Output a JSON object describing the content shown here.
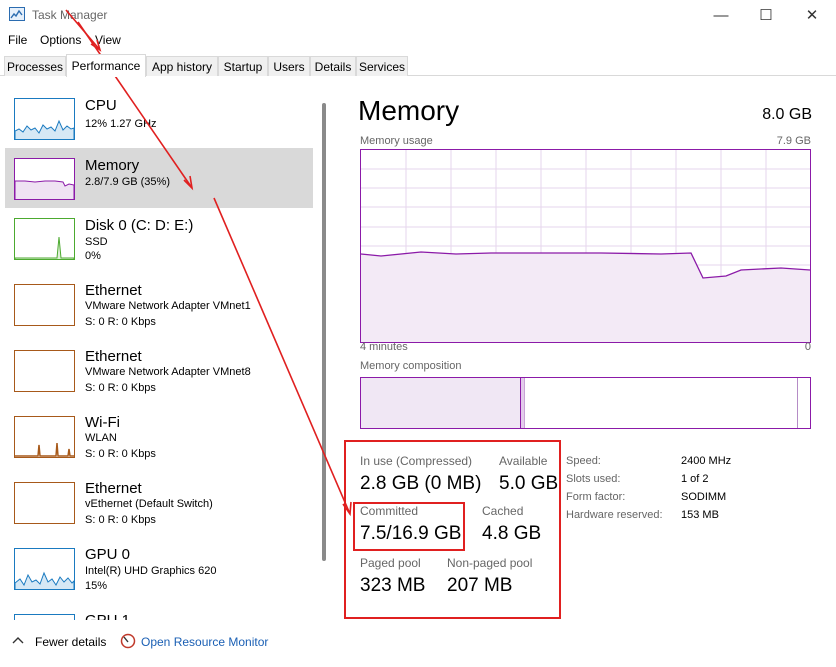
{
  "window": {
    "title": "Task Manager",
    "minimize": "—",
    "maximize": "☐",
    "close": "✕"
  },
  "menu": [
    "File",
    "Options",
    "View"
  ],
  "tabs": [
    "Processes",
    "Performance",
    "App history",
    "Startup",
    "Users",
    "Details",
    "Services"
  ],
  "active_tab": "Performance",
  "sidebar": {
    "items": [
      {
        "name": "CPU",
        "sub1": "12% 1.27 GHz",
        "sub2": "",
        "sub3": "",
        "color": "#1a7ac0"
      },
      {
        "name": "Memory",
        "sub1": "2.8/7.9 GB (35%)",
        "sub2": "",
        "sub3": "",
        "color": "#8b1aa8"
      },
      {
        "name": "Disk 0 (C: D: E:)",
        "sub1": "SSD",
        "sub2": "0%",
        "sub3": "",
        "color": "#4caa2f"
      },
      {
        "name": "Ethernet",
        "sub1": "VMware Network Adapter VMnet1",
        "sub2": "S: 0 R: 0 Kbps",
        "sub3": "",
        "color": "#a7591a"
      },
      {
        "name": "Ethernet",
        "sub1": "VMware Network Adapter VMnet8",
        "sub2": "S: 0 R: 0 Kbps",
        "sub3": "",
        "color": "#a7591a"
      },
      {
        "name": "Wi-Fi",
        "sub1": "WLAN",
        "sub2": "S: 0 R: 0 Kbps",
        "sub3": "",
        "color": "#a7591a"
      },
      {
        "name": "Ethernet",
        "sub1": "vEthernet (Default Switch)",
        "sub2": "S: 0 R: 0 Kbps",
        "sub3": "",
        "color": "#a7591a"
      },
      {
        "name": "GPU 0",
        "sub1": "Intel(R) UHD Graphics 620",
        "sub2": "15%",
        "sub3": "",
        "color": "#1a7ac0"
      },
      {
        "name": "GPU 1",
        "sub1": "",
        "sub2": "",
        "sub3": "",
        "color": "#1a7ac0"
      }
    ]
  },
  "memory": {
    "title": "Memory",
    "total": "8.0 GB",
    "usage_label": "Memory usage",
    "usage_max": "7.9 GB",
    "time_left": "4 minutes",
    "time_right": "0",
    "composition_label": "Memory composition",
    "stats": {
      "in_use_label": "In use (Compressed)",
      "in_use_value": "2.8 GB (0 MB)",
      "available_label": "Available",
      "available_value": "5.0 GB",
      "committed_label": "Committed",
      "committed_value": "7.5/16.9 GB",
      "cached_label": "Cached",
      "cached_value": "4.8 GB",
      "paged_label": "Paged pool",
      "paged_value": "323 MB",
      "nonpaged_label": "Non-paged pool",
      "nonpaged_value": "207 MB"
    },
    "specs": {
      "speed_label": "Speed:",
      "speed_value": "2400 MHz",
      "slots_label": "Slots used:",
      "slots_value": "1 of 2",
      "form_label": "Form factor:",
      "form_value": "SODIMM",
      "hw_label": "Hardware reserved:",
      "hw_value": "153 MB"
    },
    "accent": "#8b1aa8",
    "highlight": "#e02020"
  },
  "footer": {
    "fewer_details": "Fewer details",
    "resource_monitor": "Open Resource Monitor"
  }
}
